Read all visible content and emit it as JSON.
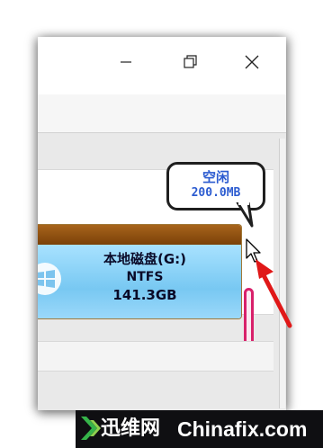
{
  "window": {
    "controls": {
      "minimize_icon": "minimize-icon",
      "maximize_icon": "restore-icon",
      "close_icon": "close-icon"
    }
  },
  "partition": {
    "name": "本地磁盘(G:)",
    "filesystem": "NTFS",
    "size": "141.3GB",
    "icon": "windows-logo-icon",
    "bar_color": "#8e5214",
    "fill_color": "#8fd6fb"
  },
  "free_space": {
    "label": "空闲",
    "size": "200.0MB",
    "bar_color": "#d8206a"
  },
  "annotation": {
    "arrow_color": "#e01818"
  },
  "footer": {
    "brand_cn": "迅维网",
    "site": "Chinafix.com"
  }
}
